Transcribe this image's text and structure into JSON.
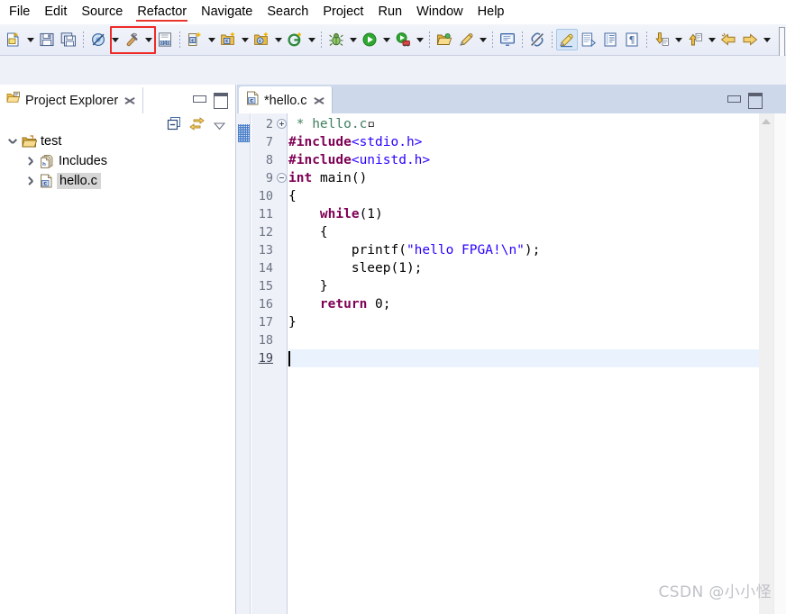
{
  "menubar": {
    "items": [
      {
        "label": "File",
        "underlined": false
      },
      {
        "label": "Edit",
        "underlined": false
      },
      {
        "label": "Source",
        "underlined": false
      },
      {
        "label": "Refactor",
        "underlined": true
      },
      {
        "label": "Navigate",
        "underlined": false
      },
      {
        "label": "Search",
        "underlined": false
      },
      {
        "label": "Project",
        "underlined": false
      },
      {
        "label": "Run",
        "underlined": false
      },
      {
        "label": "Window",
        "underlined": false
      },
      {
        "label": "Help",
        "underlined": false
      }
    ]
  },
  "toolbar": {
    "highlight_color": "#ef2b26",
    "highlighted_item": "build-button",
    "items": [
      {
        "name": "new-wizard-button",
        "icon": "new-file-icon",
        "dropdown": true
      },
      {
        "name": "save-button",
        "icon": "save-icon",
        "dropdown": false
      },
      {
        "name": "save-all-button",
        "icon": "save-all-icon",
        "dropdown": false
      },
      {
        "name": "separator-1",
        "icon": "separator",
        "dropdown": false
      },
      {
        "name": "skip-all-breakpoints-button",
        "icon": "breakpoint-skip-icon",
        "dropdown": true
      },
      {
        "name": "build-button",
        "icon": "hammer-build-icon",
        "dropdown": true
      },
      {
        "name": "toggle-binary-button",
        "icon": "binary-010-icon",
        "dropdown": false
      },
      {
        "name": "separator-2",
        "icon": "separator",
        "dropdown": false
      },
      {
        "name": "new-c-cpp-project-button",
        "icon": "new-c-project-icon",
        "dropdown": true
      },
      {
        "name": "new-c-file-button",
        "icon": "new-c-folder-icon",
        "dropdown": true
      },
      {
        "name": "new-class-button",
        "icon": "new-c-class-icon",
        "dropdown": true
      },
      {
        "name": "new-element-button",
        "icon": "new-element-g-icon",
        "dropdown": true
      },
      {
        "name": "separator-3",
        "icon": "separator",
        "dropdown": false
      },
      {
        "name": "debug-button",
        "icon": "bug-icon",
        "dropdown": true
      },
      {
        "name": "run-button",
        "icon": "run-play-icon",
        "dropdown": true
      },
      {
        "name": "external-tools-button",
        "icon": "external-tools-icon",
        "dropdown": true
      },
      {
        "name": "separator-4",
        "icon": "separator",
        "dropdown": false
      },
      {
        "name": "open-type-button",
        "icon": "open-folder-icon",
        "dropdown": false
      },
      {
        "name": "search-marker-button",
        "icon": "pencil-marker-icon",
        "dropdown": true
      },
      {
        "name": "separator-5",
        "icon": "separator",
        "dropdown": false
      },
      {
        "name": "open-console-button",
        "icon": "console-icon",
        "dropdown": false
      },
      {
        "name": "separator-6",
        "icon": "separator",
        "dropdown": false
      },
      {
        "name": "disabled-link-button",
        "icon": "no-link-icon",
        "dropdown": false
      },
      {
        "name": "separator-7",
        "icon": "separator",
        "dropdown": false
      },
      {
        "name": "toggle-mark-occurrences-button",
        "icon": "highlighter-pen-icon",
        "dropdown": false,
        "selected": true
      },
      {
        "name": "toggle-block-selection-button",
        "icon": "block-select-icon",
        "dropdown": false
      },
      {
        "name": "show-whitespace-button",
        "icon": "whitespace-lines-icon",
        "dropdown": false
      },
      {
        "name": "show-paragraph-button",
        "icon": "pilcrow-icon",
        "dropdown": false
      },
      {
        "name": "separator-8",
        "icon": "separator",
        "dropdown": false
      },
      {
        "name": "next-annotation-button",
        "icon": "next-annotation-icon",
        "dropdown": true
      },
      {
        "name": "previous-annotation-button",
        "icon": "previous-annotation-icon",
        "dropdown": true
      },
      {
        "name": "back-history-button",
        "icon": "back-arrow-icon",
        "dropdown": false
      },
      {
        "name": "forward-history-button",
        "icon": "forward-arrow-icon",
        "dropdown": true
      }
    ]
  },
  "explorer": {
    "title": "Project Explorer",
    "icon": "project-explorer-icon",
    "close_label": "close-view",
    "toolbar": [
      {
        "name": "collapse-all-button",
        "icon": "collapse-all-icon"
      },
      {
        "name": "link-with-editor-button",
        "icon": "link-with-editor-icon"
      },
      {
        "name": "view-menu-button",
        "icon": "view-menu-triangle-icon"
      }
    ],
    "window_buttons": [
      {
        "name": "minimize-view-button",
        "icon": "minimize-icon"
      },
      {
        "name": "maximize-view-button",
        "icon": "maximize-icon"
      }
    ],
    "tree": [
      {
        "label": "test",
        "icon": "project-folder-icon",
        "indent": 0,
        "twisty": "down",
        "selected": false
      },
      {
        "label": "Includes",
        "icon": "includes-icon",
        "indent": 1,
        "twisty": "right",
        "selected": false
      },
      {
        "label": "hello.c",
        "icon": "c-file-icon",
        "indent": 1,
        "twisty": "right",
        "selected": true
      }
    ]
  },
  "editor": {
    "tab": {
      "label": "*hello.c",
      "icon": "c-file-icon",
      "dirty": true,
      "close_label": "close-editor"
    },
    "window_buttons": [
      {
        "name": "minimize-editor-button",
        "icon": "minimize-icon"
      },
      {
        "name": "maximize-editor-button",
        "icon": "maximize-icon"
      }
    ],
    "scrollbar": {
      "name": "editor-vertical-scrollbar",
      "up_arrow": "scroll-up-arrow-icon"
    },
    "cursor_line": 19,
    "lines": [
      {
        "num": "2",
        "fold": "plus",
        "marker": false,
        "current": false,
        "tokens": [
          {
            "t": " * hello.c",
            "c": "cm"
          },
          {
            "t": "▫",
            "c": "pl"
          }
        ]
      },
      {
        "num": "7",
        "fold": "",
        "marker": true,
        "current": false,
        "tokens": [
          {
            "t": "#include",
            "c": "pp"
          },
          {
            "t": "<stdio.h>",
            "c": "hd"
          }
        ]
      },
      {
        "num": "8",
        "fold": "",
        "marker": false,
        "current": false,
        "tokens": [
          {
            "t": "#include",
            "c": "pp"
          },
          {
            "t": "<unistd.h>",
            "c": "hd"
          }
        ]
      },
      {
        "num": "9",
        "fold": "minus",
        "marker": false,
        "current": false,
        "tokens": [
          {
            "t": "int",
            "c": "k"
          },
          {
            "t": " ",
            "c": "pl"
          },
          {
            "t": "main",
            "c": "pl"
          },
          {
            "t": "()",
            "c": "pl"
          }
        ]
      },
      {
        "num": "10",
        "fold": "",
        "marker": false,
        "current": false,
        "tokens": [
          {
            "t": "{",
            "c": "pl"
          }
        ]
      },
      {
        "num": "11",
        "fold": "",
        "marker": false,
        "current": false,
        "tokens": [
          {
            "t": "    ",
            "c": "pl"
          },
          {
            "t": "while",
            "c": "k"
          },
          {
            "t": "(1)",
            "c": "pl"
          }
        ]
      },
      {
        "num": "12",
        "fold": "",
        "marker": false,
        "current": false,
        "tokens": [
          {
            "t": "    {",
            "c": "pl"
          }
        ]
      },
      {
        "num": "13",
        "fold": "",
        "marker": false,
        "current": false,
        "tokens": [
          {
            "t": "        printf(",
            "c": "pl"
          },
          {
            "t": "\"hello FPGA!\\n\"",
            "c": "st"
          },
          {
            "t": ");",
            "c": "pl"
          }
        ]
      },
      {
        "num": "14",
        "fold": "",
        "marker": false,
        "current": false,
        "tokens": [
          {
            "t": "        sleep(1);",
            "c": "pl"
          }
        ]
      },
      {
        "num": "15",
        "fold": "",
        "marker": false,
        "current": false,
        "tokens": [
          {
            "t": "    }",
            "c": "pl"
          }
        ]
      },
      {
        "num": "16",
        "fold": "",
        "marker": false,
        "current": false,
        "tokens": [
          {
            "t": "    ",
            "c": "pl"
          },
          {
            "t": "return",
            "c": "k"
          },
          {
            "t": " 0;",
            "c": "pl"
          }
        ]
      },
      {
        "num": "17",
        "fold": "",
        "marker": false,
        "current": false,
        "tokens": [
          {
            "t": "}",
            "c": "pl"
          }
        ]
      },
      {
        "num": "18",
        "fold": "",
        "marker": false,
        "current": false,
        "tokens": [
          {
            "t": "",
            "c": "pl"
          }
        ]
      },
      {
        "num": "19",
        "fold": "",
        "marker": false,
        "current": true,
        "tokens": [
          {
            "t": "",
            "c": "pl"
          }
        ]
      }
    ]
  },
  "watermark": {
    "text": "CSDN @小小怪"
  }
}
